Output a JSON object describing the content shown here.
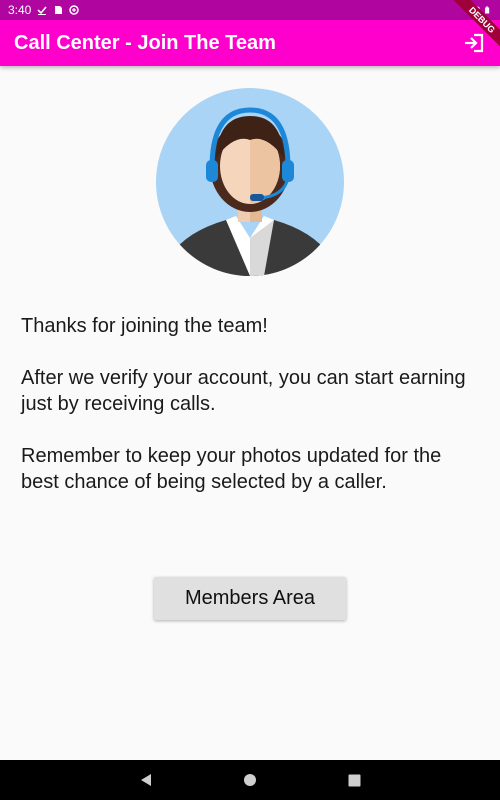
{
  "status_bar": {
    "time": "3:40",
    "icons": [
      "download-check-icon",
      "sim-card-icon",
      "data-saver-icon",
      "wifi-icon",
      "battery-icon"
    ]
  },
  "app_bar": {
    "title": "Call Center - Join The Team",
    "action_icon": "logout-icon",
    "debug_banner": "DEBUG",
    "color": "#ff00cc"
  },
  "avatar": {
    "icon": "call-center-agent-avatar",
    "background": "#a9d4f5"
  },
  "message": {
    "paragraph_1": "Thanks for joining the team!",
    "paragraph_2": "After we verify your account, you can start earning just by receiving calls.",
    "paragraph_3": "Remember to keep your photos updated for the best chance of being selected by a caller."
  },
  "members_button": {
    "label": "Members Area"
  },
  "nav_bar": {
    "icons": [
      "back-icon",
      "home-icon",
      "recents-icon"
    ]
  }
}
